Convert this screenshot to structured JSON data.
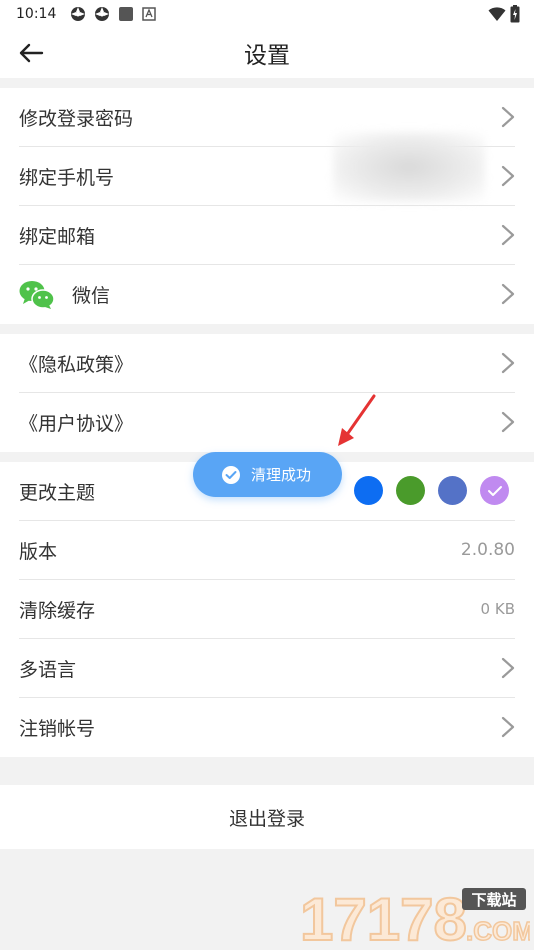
{
  "status_bar": {
    "time": "10:14"
  },
  "header": {
    "title": "设置"
  },
  "account_section": {
    "items": [
      {
        "label": "修改登录密码"
      },
      {
        "label": "绑定手机号"
      },
      {
        "label": "绑定邮箱"
      },
      {
        "label": "微信"
      }
    ]
  },
  "legal_section": {
    "items": [
      {
        "label": "《隐私政策》"
      },
      {
        "label": "《用户协议》"
      }
    ]
  },
  "settings_section": {
    "theme": {
      "label": "更改主题",
      "colors": [
        "#0d6df2",
        "#4a9b2b",
        "#5472c7",
        "#c08af0"
      ],
      "selected_index": 3
    },
    "version": {
      "label": "版本",
      "value": "2.0.80"
    },
    "clear_cache": {
      "label": "清除缓存",
      "value": "0 KB"
    },
    "language": {
      "label": "多语言"
    },
    "deactivate": {
      "label": "注销帐号"
    }
  },
  "logout": {
    "label": "退出登录"
  },
  "toast": {
    "text": "清理成功"
  },
  "watermark": {
    "brand": "17178",
    "sub": "下载站",
    "domain": ".COM"
  },
  "colors": {
    "accent": "#59a5f5",
    "wechat": "#4fc24a",
    "annotation_arrow": "#e53333"
  }
}
